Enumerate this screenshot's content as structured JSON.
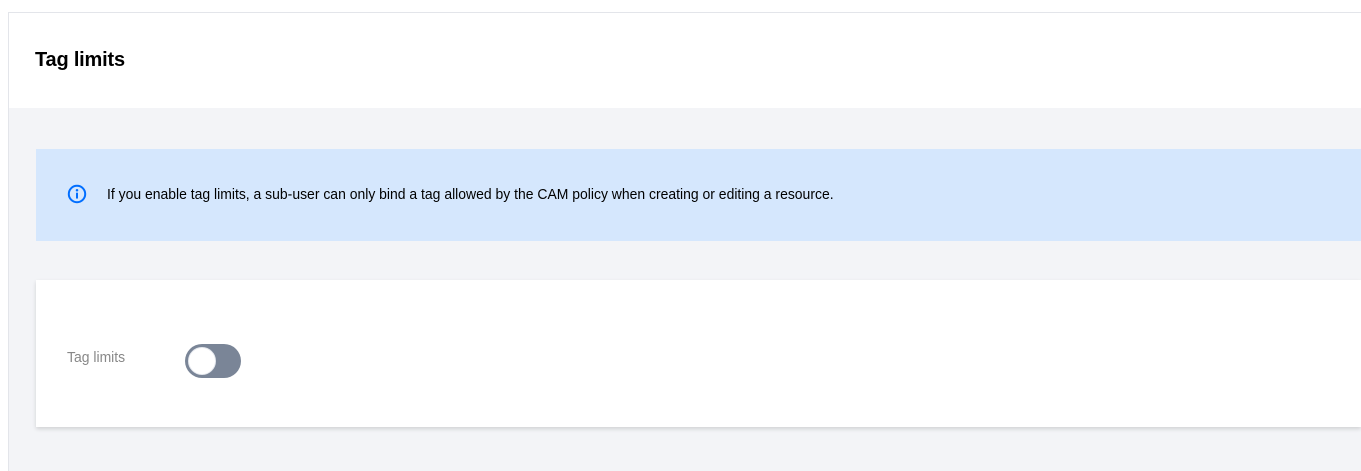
{
  "header": {
    "title": "Tag limits"
  },
  "info_banner": {
    "icon": "info-circle-icon",
    "text": "If you enable tag limits, a sub-user can only bind a tag allowed by the CAM policy when creating or editing a resource.",
    "background_color": "#d5e7fd",
    "icon_color": "#006eff"
  },
  "settings": {
    "tag_limits": {
      "label": "Tag limits",
      "enabled": false,
      "toggle_color": "#7a8597"
    }
  }
}
